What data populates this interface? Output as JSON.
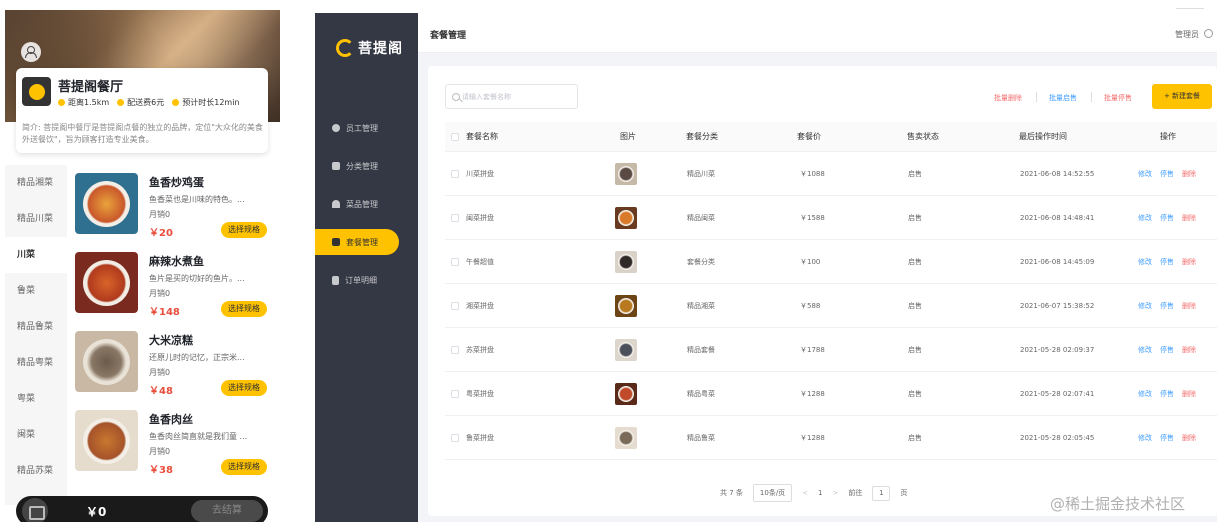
{
  "mobile": {
    "store": {
      "name": "菩提阁餐厅",
      "distance": "距离1.5km",
      "delivery_fee": "配送费6元",
      "eta": "预计时长12min",
      "description": "简介: 菩提阁中餐厅是菩提阁点餐的独立的品牌，定位\"大众化的美食外送餐饮\"，旨为顾客打造专业美食。"
    },
    "categories": [
      "精品湘菜",
      "精品川菜",
      "川菜",
      "鲁菜",
      "精品鲁菜",
      "精品粤菜",
      "粤菜",
      "闽菜",
      "精品苏菜"
    ],
    "active_category": "川菜",
    "dishes": [
      {
        "name": "鱼香炒鸡蛋",
        "desc": "鱼香菜也是川味的特色。...",
        "sales": "月销0",
        "price": "￥20",
        "button": "选择规格"
      },
      {
        "name": "麻辣水煮鱼",
        "desc": "鱼片是买的切好的鱼片。...",
        "sales": "月销0",
        "price": "￥148",
        "button": "选择规格"
      },
      {
        "name": "大米凉糕",
        "desc": "还原儿时的记忆，正宗米...",
        "sales": "月销0",
        "price": "￥48",
        "button": "选择规格"
      },
      {
        "name": "鱼香肉丝",
        "desc": "鱼香肉丝简直就是我们童 ...",
        "sales": "月销0",
        "price": "￥38",
        "button": "选择规格"
      }
    ],
    "cart": {
      "total": "￥0",
      "checkout": "去结算"
    }
  },
  "admin": {
    "logo_text": "菩提阁",
    "menu": [
      {
        "label": "员工管理",
        "icon": "info-icon"
      },
      {
        "label": "分类管理",
        "icon": "grid-icon"
      },
      {
        "label": "菜品管理",
        "icon": "dish-icon"
      },
      {
        "label": "套餐管理",
        "icon": "package-icon"
      },
      {
        "label": "订单明细",
        "icon": "order-icon"
      }
    ],
    "active_menu": "套餐管理",
    "page_title": "套餐管理",
    "user": "管理员",
    "search_placeholder": "请输入套餐名称",
    "actions": {
      "batch_delete": "批量删除",
      "batch_enable": "批量启售",
      "batch_disable": "批量停售",
      "new": "+ 新建套餐"
    },
    "columns": [
      "套餐名称",
      "图片",
      "套餐分类",
      "套餐价",
      "售卖状态",
      "最后操作时间",
      "操作"
    ],
    "rows": [
      {
        "name": "川菜拼盘",
        "category": "精品川菜",
        "price": "￥1088",
        "status": "启售",
        "time": "2021-06-08 14:52:55"
      },
      {
        "name": "闽菜拼盘",
        "category": "精品闽菜",
        "price": "￥1588",
        "status": "启售",
        "time": "2021-06-08 14:48:41"
      },
      {
        "name": "午餐超值",
        "category": "套餐分类",
        "price": "￥100",
        "status": "启售",
        "time": "2021-06-08 14:45:09"
      },
      {
        "name": "湘菜拼盘",
        "category": "精品湘菜",
        "price": "￥588",
        "status": "启售",
        "time": "2021-06-07 15:38:52"
      },
      {
        "name": "苏菜拼盘",
        "category": "精品套餐",
        "price": "￥1788",
        "status": "启售",
        "time": "2021-05-28 02:09:37"
      },
      {
        "name": "粤菜拼盘",
        "category": "精品粤菜",
        "price": "￥1288",
        "status": "启售",
        "time": "2021-05-28 02:07:41"
      },
      {
        "name": "鲁菜拼盘",
        "category": "精品鲁菜",
        "price": "￥1288",
        "status": "启售",
        "time": "2021-05-28 02:05:45"
      }
    ],
    "row_ops": {
      "edit": "修改",
      "toggle": "停售",
      "delete": "删除"
    },
    "pagination": {
      "total": "共 7 条",
      "page_size": "10条/页",
      "prev": "<",
      "page": "1",
      "next": ">",
      "goto": "前往",
      "goto_value": "1",
      "page_unit": "页"
    }
  },
  "watermark": "@稀土掘金技术社区",
  "colors": {
    "accent": "#ffc200",
    "sidebar": "#343744",
    "price": "#e94e3c",
    "link": "#419eff",
    "danger": "#f56c6c"
  }
}
